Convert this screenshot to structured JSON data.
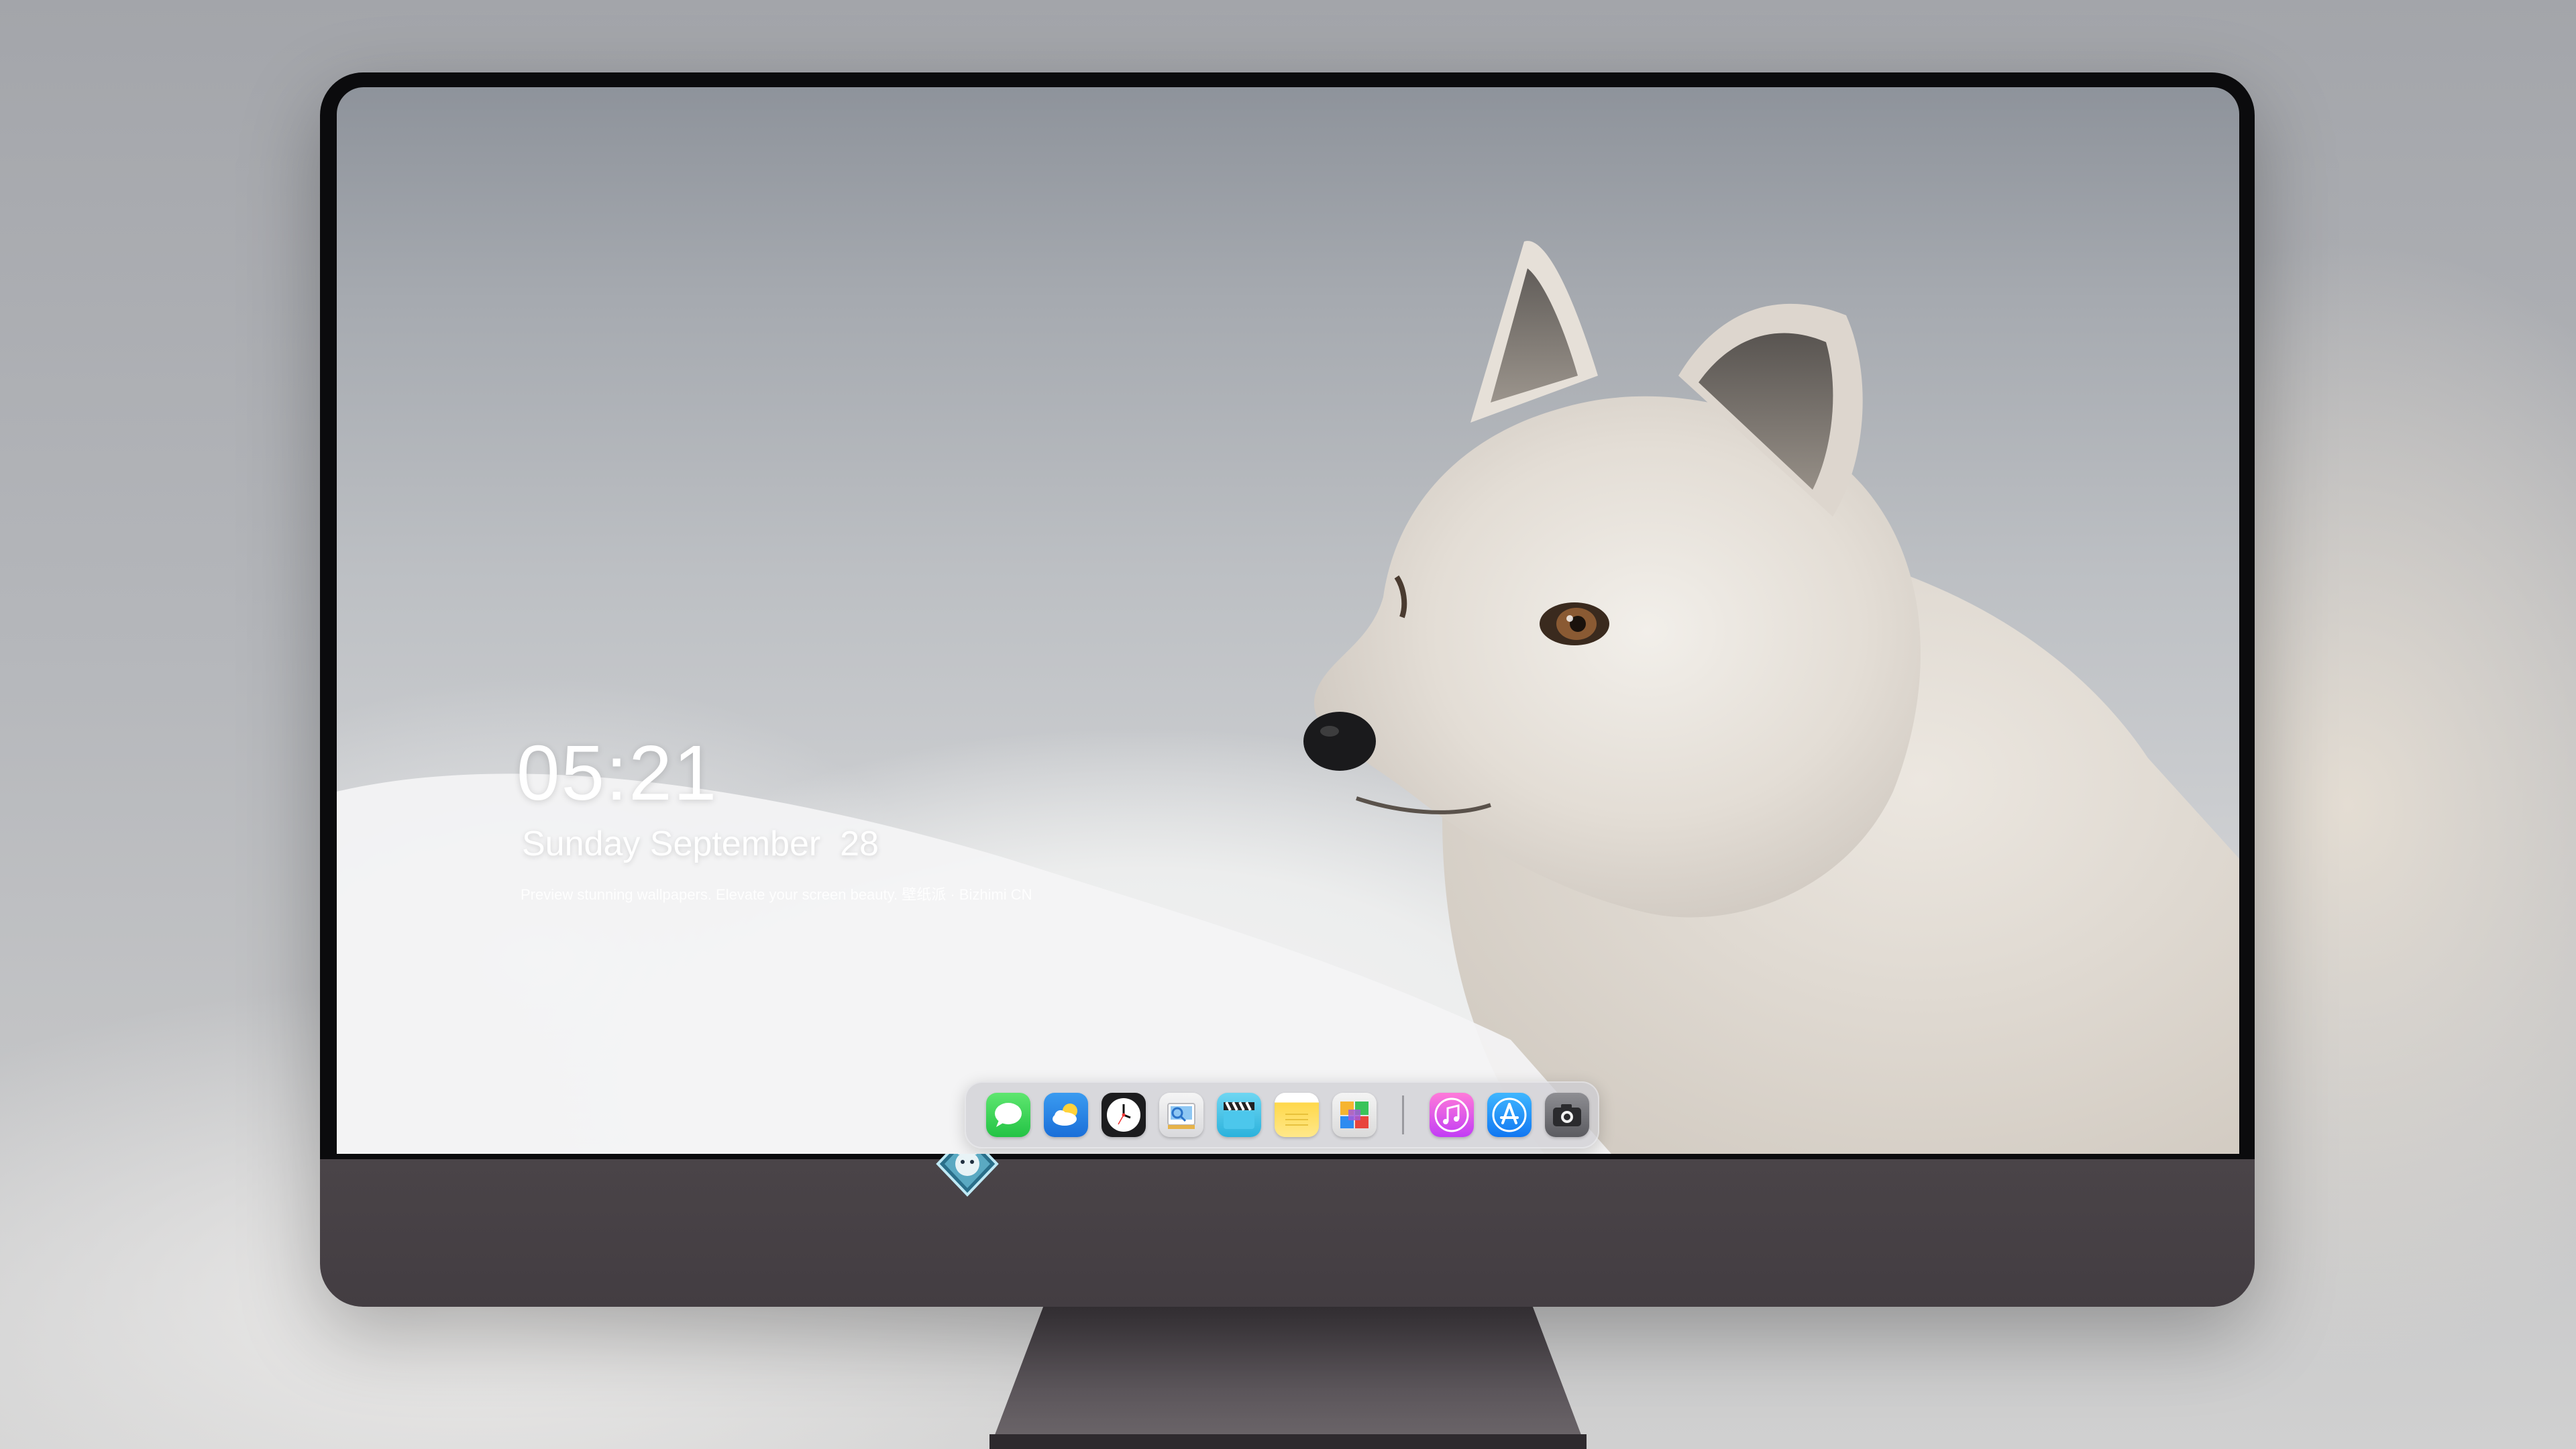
{
  "desktop": {
    "time": "05:21",
    "date": "Sunday September  28",
    "tagline": "Preview stunning wallpapers. Elevate your screen beauty. 壁纸派 · Bizhimi CN"
  },
  "dock": {
    "apps": [
      {
        "name": "messages-icon",
        "label": "Messages"
      },
      {
        "name": "weather-icon",
        "label": "Weather"
      },
      {
        "name": "clock-icon",
        "label": "Clock"
      },
      {
        "name": "preview-icon",
        "label": "Preview"
      },
      {
        "name": "clips-icon",
        "label": "Clips"
      },
      {
        "name": "notes-icon",
        "label": "Notes"
      },
      {
        "name": "photos-icon",
        "label": "Photos"
      },
      {
        "name": "music-icon",
        "label": "Music"
      },
      {
        "name": "app-store-icon",
        "label": "App Store"
      },
      {
        "name": "camera-icon",
        "label": "Camera"
      }
    ]
  },
  "colors": {
    "chin": "#4a4448",
    "bezel": "#0b0b0d",
    "dock": "#cdcdd2",
    "text": "#ffffff"
  }
}
